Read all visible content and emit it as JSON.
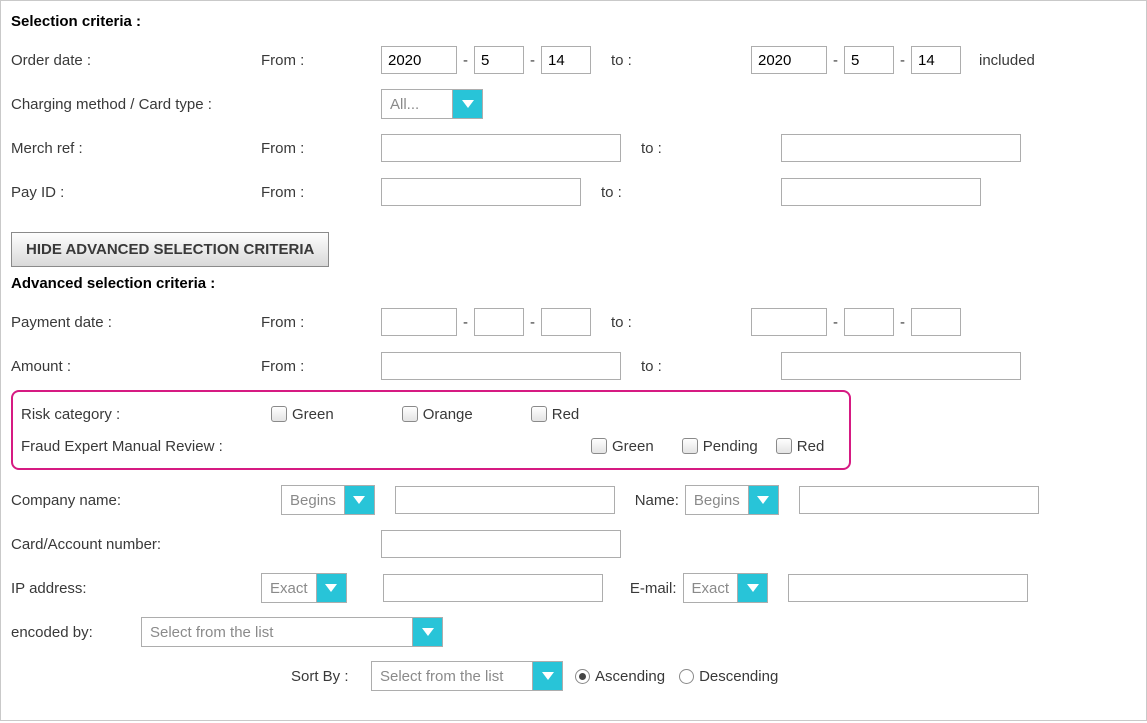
{
  "titles": {
    "selection": "Selection criteria :",
    "advanced": "Advanced selection criteria :"
  },
  "labels": {
    "order_date": "Order date :",
    "from": "From :",
    "to": "to :",
    "included": "included",
    "charging_method": "Charging method / Card type :",
    "merch_ref": "Merch ref :",
    "pay_id": "Pay ID :",
    "payment_date": "Payment date :",
    "amount": "Amount :",
    "risk_category": "Risk category :",
    "fraud_review": "Fraud Expert Manual Review :",
    "company_name": "Company name:",
    "name": "Name:",
    "card_account": "Card/Account number:",
    "ip_address": "IP address:",
    "email": "E-mail:",
    "encoded_by": "encoded by:",
    "sort_by": "Sort By :",
    "ascending": "Ascending",
    "descending": "Descending"
  },
  "buttons": {
    "hide_advanced": "HIDE ADVANCED SELECTION CRITERIA"
  },
  "dropdowns": {
    "all": "All...",
    "begins": "Begins",
    "exact": "Exact",
    "select_list": "Select from the list"
  },
  "risk_options": {
    "green": "Green",
    "orange": "Orange",
    "red": "Red"
  },
  "fraud_options": {
    "green": "Green",
    "pending": "Pending",
    "red": "Red"
  },
  "values": {
    "order_from": {
      "y": "2020",
      "m": "5",
      "d": "14"
    },
    "order_to": {
      "y": "2020",
      "m": "5",
      "d": "14"
    }
  },
  "sort_direction": "asc"
}
